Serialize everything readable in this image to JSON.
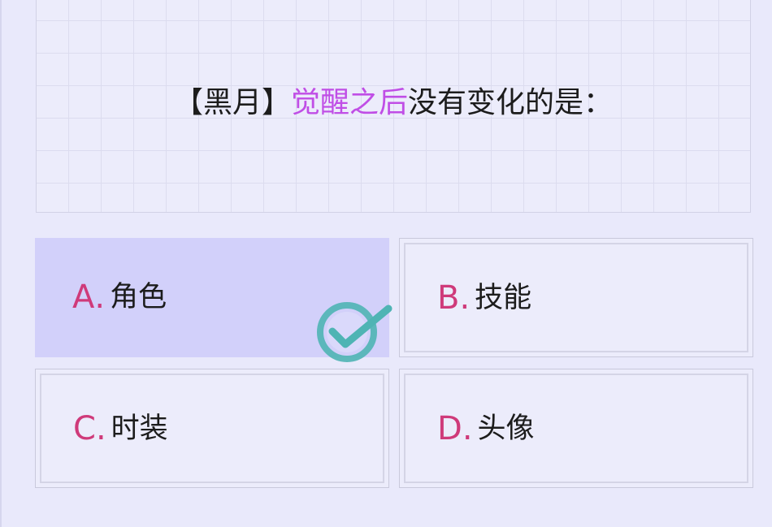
{
  "question": {
    "prefix": "【黑月】",
    "highlight": "觉醒之后",
    "suffix": "没有变化的是："
  },
  "options": [
    {
      "letter": "A",
      "text": "角色",
      "selected": true
    },
    {
      "letter": "B",
      "text": "技能",
      "selected": false
    },
    {
      "letter": "C",
      "text": "时装",
      "selected": false
    },
    {
      "letter": "D",
      "text": "头像",
      "selected": false
    }
  ],
  "colors": {
    "background": "#e9e9fb",
    "highlight": "#c04ee6",
    "option_letter": "#cf3a7a",
    "selected_option": "#d2d0fa",
    "check": "#4fb4b4"
  },
  "icons": {
    "correct_mark": "check-circle-icon"
  }
}
